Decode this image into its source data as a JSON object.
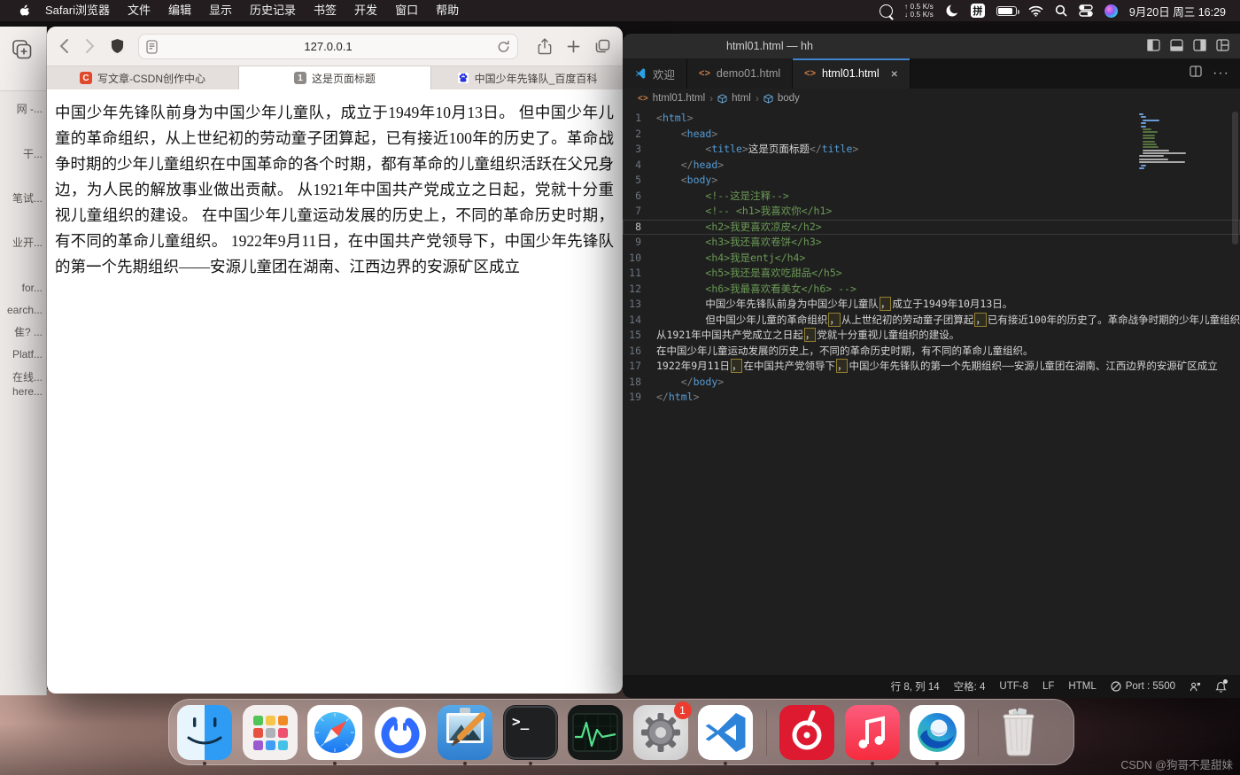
{
  "menu_bar": {
    "app_menus": [
      "Safari浏览器",
      "文件",
      "编辑",
      "显示",
      "历史记录",
      "书签",
      "开发",
      "窗口",
      "帮助"
    ],
    "net_up": "↑ 0.5 K/s",
    "net_down": "↓ 0.5 K/s",
    "input_method": "拼",
    "datetime": "9月20日 周三 16:29"
  },
  "background_window": {
    "items": [
      "网 -...",
      "干...",
      "笔试...",
      "业开...",
      "for...",
      "earch...",
      "隹? ...",
      "Platf...",
      "在线...",
      "here..."
    ]
  },
  "safari": {
    "url": "127.0.0.1",
    "tabs": [
      {
        "label": "写文章-CSDN创作中心"
      },
      {
        "label": "这是页面标题"
      },
      {
        "label": "中国少年先锋队_百度百科"
      }
    ],
    "tab2_badge": "1",
    "csdn_badge": "C",
    "content": "中国少年先锋队前身为中国少年儿童队，成立于1949年10月13日。 但中国少年儿童的革命组织，从上世纪初的劳动童子团算起，已有接近100年的历史了。革命战争时期的少年儿童组织在中国革命的各个时期，都有革命的儿童组织活跃在父兄身边，为人民的解放事业做出贡献。 从1921年中国共产党成立之日起，党就十分重视儿童组织的建设。 在中国少年儿童运动发展的历史上，不同的革命历史时期，有不同的革命儿童组织。 1922年9月11日，在中国共产党领导下，中国少年先锋队的第一个先期组织——安源儿童团在湖南、江西边界的安源矿区成立"
  },
  "vscode": {
    "window_title": "html01.html — hh",
    "tabs": [
      {
        "label": "欢迎"
      },
      {
        "label": "demo01.html"
      },
      {
        "label": "html01.html",
        "close": "×"
      }
    ],
    "breadcrumbs": [
      "html01.html",
      "html",
      "body"
    ],
    "current_line": 8,
    "code": [
      [
        [
          "p",
          "<"
        ],
        [
          "t",
          "html"
        ],
        [
          "p",
          ">"
        ]
      ],
      [
        [
          "w",
          "    "
        ],
        [
          "p",
          "<"
        ],
        [
          "t",
          "head"
        ],
        [
          "p",
          ">"
        ]
      ],
      [
        [
          "w",
          "        "
        ],
        [
          "p",
          "<"
        ],
        [
          "t",
          "title"
        ],
        [
          "p",
          ">"
        ],
        [
          "w",
          "这是页面标题"
        ],
        [
          "p",
          "</"
        ],
        [
          "t",
          "title"
        ],
        [
          "p",
          ">"
        ]
      ],
      [
        [
          "w",
          "    "
        ],
        [
          "p",
          "</"
        ],
        [
          "t",
          "head"
        ],
        [
          "p",
          ">"
        ]
      ],
      [
        [
          "w",
          "    "
        ],
        [
          "p",
          "<"
        ],
        [
          "t",
          "body"
        ],
        [
          "p",
          ">"
        ]
      ],
      [
        [
          "w",
          "        "
        ],
        [
          "c",
          "<!--这是注释-->"
        ]
      ],
      [
        [
          "w",
          "        "
        ],
        [
          "c",
          "<!-- <h1>我喜欢你</h1>"
        ]
      ],
      [
        [
          "w",
          "        "
        ],
        [
          "c",
          "<h2>我更喜欢凉皮</h2>"
        ]
      ],
      [
        [
          "w",
          "        "
        ],
        [
          "c",
          "<h3>我还喜欢卷饼</h3>"
        ]
      ],
      [
        [
          "w",
          "        "
        ],
        [
          "c",
          "<h4>我是entj</h4>"
        ]
      ],
      [
        [
          "w",
          "        "
        ],
        [
          "c",
          "<h5>我还是喜欢吃甜品</h5>"
        ]
      ],
      [
        [
          "w",
          "        "
        ],
        [
          "c",
          "<h6>我最喜欢看美女</h6> -->"
        ]
      ],
      [
        [
          "w",
          "        中国少年先锋队前身为中国少年儿童队"
        ],
        [
          "k",
          "，"
        ],
        [
          "w",
          "成立于1949年10月13日。"
        ]
      ],
      [
        [
          "w",
          "        但中国少年儿童的革命组织"
        ],
        [
          "k",
          "，"
        ],
        [
          "w",
          "从上世纪初的劳动童子团算起"
        ],
        [
          "k",
          "，"
        ],
        [
          "w",
          "已有接近100年的历史了。革命战争时期的少年儿童组织在"
        ]
      ],
      [
        [
          "w",
          "从1921年中国共产党成立之日起"
        ],
        [
          "k",
          "，"
        ],
        [
          "w",
          "党就十分重视儿童组织的建设。"
        ]
      ],
      [
        [
          "w",
          "在中国少年儿童运动发展的历史上，不同的革命历史时期，有不同的革命儿童组织。"
        ]
      ],
      [
        [
          "w",
          "1922年9月11日"
        ],
        [
          "k",
          "，"
        ],
        [
          "w",
          "在中国共产党领导下"
        ],
        [
          "k",
          "，"
        ],
        [
          "w",
          "中国少年先锋队的第一个先期组织——安源儿童团在湖南、江西边界的安源矿区成立"
        ]
      ],
      [
        [
          "w",
          "    "
        ],
        [
          "p",
          "</"
        ],
        [
          "t",
          "body"
        ],
        [
          "p",
          ">"
        ]
      ],
      [
        [
          "p",
          "</"
        ],
        [
          "t",
          "html"
        ],
        [
          "p",
          ">"
        ]
      ]
    ],
    "status": {
      "cursor": "行 8, 列 14",
      "spaces": "空格: 4",
      "encoding": "UTF-8",
      "eol": "LF",
      "lang": "HTML",
      "port": "Port : 5500"
    },
    "colors": {
      "accent_tab_border": "#3f83cc",
      "tag": "#569cd6",
      "comment": "#6a9955"
    }
  },
  "dock": {
    "items": [
      "finder",
      "launchpad",
      "safari",
      "chat-app",
      "screenshot-editor",
      "terminal",
      "activity-monitor",
      "system-settings",
      "vscode",
      "netease-music",
      "apple-music",
      "edge",
      "trash"
    ],
    "settings_badge": "1"
  },
  "watermark": "CSDN @狗哥不是甜妹"
}
